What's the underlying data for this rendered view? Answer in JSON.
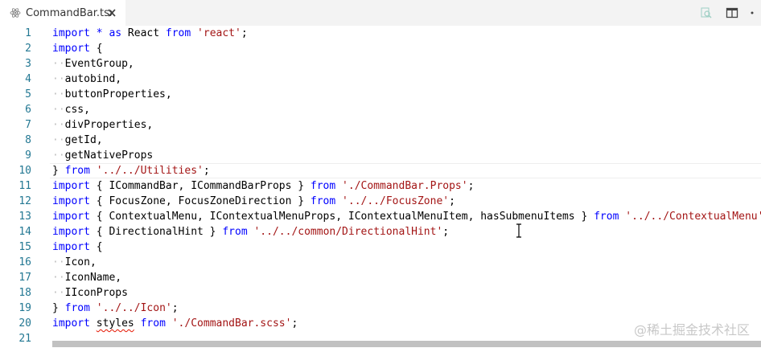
{
  "tab": {
    "filename": "CommandBar.tsx",
    "icon": "react-file-icon",
    "close_icon": "close-icon"
  },
  "actions": [
    {
      "icon": "open-changes-icon"
    },
    {
      "icon": "split-editor-icon"
    },
    {
      "icon": "more-actions-icon"
    }
  ],
  "colors": {
    "keyword": "#0000ff",
    "string": "#a31515",
    "line_number": "#237893",
    "text": "#000000",
    "whitespace": "#bfbfbf"
  },
  "editor": {
    "lines": [
      {
        "n": "1",
        "tokens": [
          {
            "t": "kw",
            "v": "import"
          },
          {
            "t": "p",
            "v": " "
          },
          {
            "t": "kw",
            "v": "*"
          },
          {
            "t": "p",
            "v": " "
          },
          {
            "t": "kw",
            "v": "as"
          },
          {
            "t": "p",
            "v": " React "
          },
          {
            "t": "kw",
            "v": "from"
          },
          {
            "t": "p",
            "v": " "
          },
          {
            "t": "st",
            "v": "'react'"
          },
          {
            "t": "p",
            "v": ";"
          }
        ]
      },
      {
        "n": "2",
        "tokens": [
          {
            "t": "kw",
            "v": "import"
          },
          {
            "t": "p",
            "v": " {"
          }
        ]
      },
      {
        "n": "3",
        "tokens": [
          {
            "t": "ws",
            "v": "··"
          },
          {
            "t": "p",
            "v": "EventGroup,"
          }
        ]
      },
      {
        "n": "4",
        "tokens": [
          {
            "t": "ws",
            "v": "··"
          },
          {
            "t": "p",
            "v": "autobind,"
          }
        ]
      },
      {
        "n": "5",
        "tokens": [
          {
            "t": "ws",
            "v": "··"
          },
          {
            "t": "p",
            "v": "buttonProperties,"
          }
        ]
      },
      {
        "n": "6",
        "tokens": [
          {
            "t": "ws",
            "v": "··"
          },
          {
            "t": "p",
            "v": "css,"
          }
        ]
      },
      {
        "n": "7",
        "tokens": [
          {
            "t": "ws",
            "v": "··"
          },
          {
            "t": "p",
            "v": "divProperties,"
          }
        ]
      },
      {
        "n": "8",
        "tokens": [
          {
            "t": "ws",
            "v": "··"
          },
          {
            "t": "p",
            "v": "getId,"
          }
        ]
      },
      {
        "n": "9",
        "tokens": [
          {
            "t": "ws",
            "v": "··"
          },
          {
            "t": "p",
            "v": "getNativeProps"
          }
        ]
      },
      {
        "n": "10",
        "tokens": [
          {
            "t": "p",
            "v": "} "
          },
          {
            "t": "kw",
            "v": "from"
          },
          {
            "t": "p",
            "v": " "
          },
          {
            "t": "st",
            "v": "'../../Utilities'"
          },
          {
            "t": "p",
            "v": ";"
          }
        ]
      },
      {
        "n": "11",
        "tokens": [
          {
            "t": "kw",
            "v": "import"
          },
          {
            "t": "p",
            "v": " { ICommandBar, ICommandBarProps } "
          },
          {
            "t": "kw",
            "v": "from"
          },
          {
            "t": "p",
            "v": " "
          },
          {
            "t": "st",
            "v": "'./CommandBar.Props'"
          },
          {
            "t": "p",
            "v": ";"
          }
        ]
      },
      {
        "n": "12",
        "tokens": [
          {
            "t": "kw",
            "v": "import"
          },
          {
            "t": "p",
            "v": " { FocusZone, FocusZoneDirection } "
          },
          {
            "t": "kw",
            "v": "from"
          },
          {
            "t": "p",
            "v": " "
          },
          {
            "t": "st",
            "v": "'../../FocusZone'"
          },
          {
            "t": "p",
            "v": ";"
          }
        ]
      },
      {
        "n": "13",
        "tokens": [
          {
            "t": "kw",
            "v": "import"
          },
          {
            "t": "p",
            "v": " { ContextualMenu, IContextualMenuProps, IContextualMenuItem, hasSubmenuItems } "
          },
          {
            "t": "kw",
            "v": "from"
          },
          {
            "t": "p",
            "v": " "
          },
          {
            "t": "st",
            "v": "'../../ContextualMenu'"
          },
          {
            "t": "p",
            "v": ";"
          }
        ]
      },
      {
        "n": "14",
        "tokens": [
          {
            "t": "kw",
            "v": "import"
          },
          {
            "t": "p",
            "v": " { DirectionalHint } "
          },
          {
            "t": "kw",
            "v": "from"
          },
          {
            "t": "p",
            "v": " "
          },
          {
            "t": "st",
            "v": "'../../common/DirectionalHint'"
          },
          {
            "t": "p",
            "v": ";"
          }
        ]
      },
      {
        "n": "15",
        "tokens": [
          {
            "t": "kw",
            "v": "import"
          },
          {
            "t": "p",
            "v": " {"
          }
        ]
      },
      {
        "n": "16",
        "tokens": [
          {
            "t": "ws",
            "v": "··"
          },
          {
            "t": "p",
            "v": "Icon,"
          }
        ]
      },
      {
        "n": "17",
        "tokens": [
          {
            "t": "ws",
            "v": "··"
          },
          {
            "t": "p",
            "v": "IconName,"
          }
        ]
      },
      {
        "n": "18",
        "tokens": [
          {
            "t": "ws",
            "v": "··"
          },
          {
            "t": "p",
            "v": "IIconProps"
          }
        ]
      },
      {
        "n": "19",
        "tokens": [
          {
            "t": "p",
            "v": "} "
          },
          {
            "t": "kw",
            "v": "from"
          },
          {
            "t": "p",
            "v": " "
          },
          {
            "t": "st",
            "v": "'../../Icon'"
          },
          {
            "t": "p",
            "v": ";"
          }
        ]
      },
      {
        "n": "20",
        "tokens": [
          {
            "t": "kw",
            "v": "import"
          },
          {
            "t": "p",
            "v": " "
          },
          {
            "t": "sq",
            "v": "styles"
          },
          {
            "t": "p",
            "v": " "
          },
          {
            "t": "kw",
            "v": "from"
          },
          {
            "t": "p",
            "v": " "
          },
          {
            "t": "st",
            "v": "'./CommandBar.scss'"
          },
          {
            "t": "p",
            "v": ";"
          }
        ]
      },
      {
        "n": "21",
        "tokens": []
      }
    ]
  },
  "watermark": "@稀土掘金技术社区"
}
